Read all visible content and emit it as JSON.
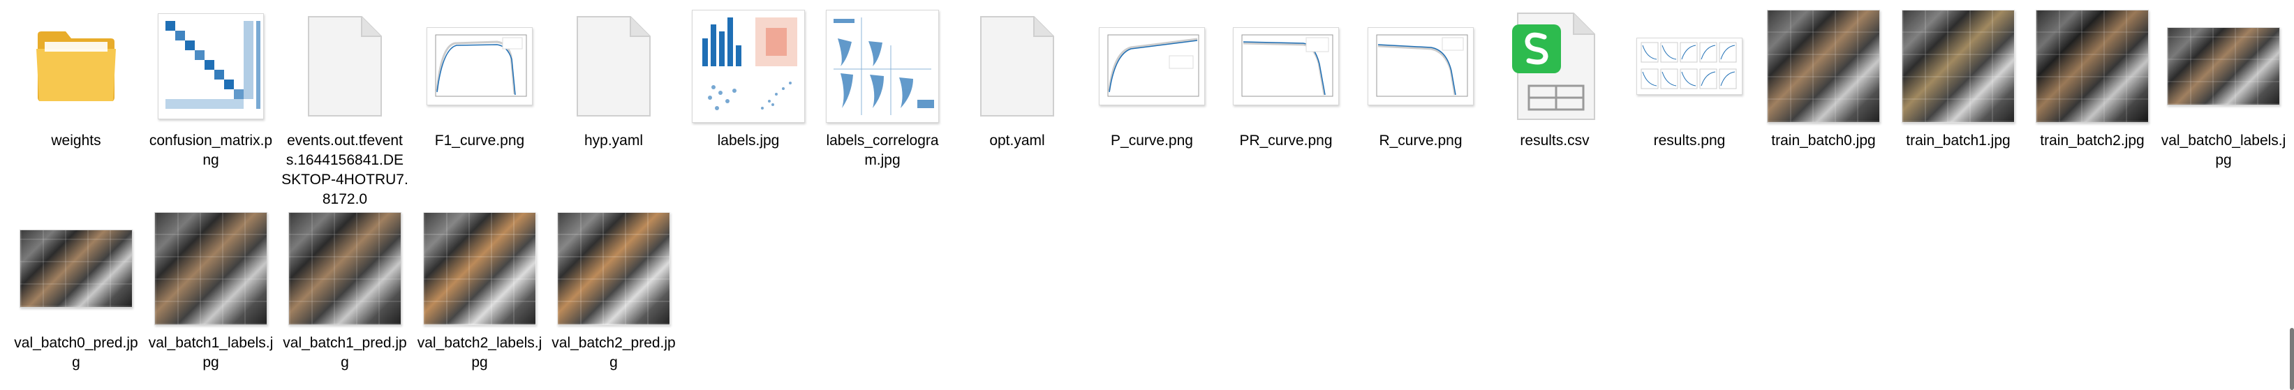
{
  "files": [
    {
      "name": "weights",
      "kind": "folder"
    },
    {
      "name": "confusion_matrix.png",
      "kind": "confusion"
    },
    {
      "name": "events.out.tfevents.1644156841.DESKTOP-4HOTRU7.8172.0",
      "kind": "blank"
    },
    {
      "name": "F1_curve.png",
      "kind": "curve"
    },
    {
      "name": "hyp.yaml",
      "kind": "blank"
    },
    {
      "name": "labels.jpg",
      "kind": "labels"
    },
    {
      "name": "labels_correlogram.jpg",
      "kind": "correlogram"
    },
    {
      "name": "opt.yaml",
      "kind": "blank"
    },
    {
      "name": "P_curve.png",
      "kind": "curve"
    },
    {
      "name": "PR_curve.png",
      "kind": "curve"
    },
    {
      "name": "R_curve.png",
      "kind": "curve"
    },
    {
      "name": "results.csv",
      "kind": "csv"
    },
    {
      "name": "results.png",
      "kind": "results"
    },
    {
      "name": "train_batch0.jpg",
      "kind": "photo"
    },
    {
      "name": "train_batch1.jpg",
      "kind": "photo"
    },
    {
      "name": "train_batch2.jpg",
      "kind": "photo"
    },
    {
      "name": "val_batch0_labels.jpg",
      "kind": "photo-wide"
    },
    {
      "name": "val_batch0_pred.jpg",
      "kind": "photo-wide"
    },
    {
      "name": "val_batch1_labels.jpg",
      "kind": "photo"
    },
    {
      "name": "val_batch1_pred.jpg",
      "kind": "photo"
    },
    {
      "name": "val_batch2_labels.jpg",
      "kind": "photo"
    },
    {
      "name": "val_batch2_pred.jpg",
      "kind": "photo"
    }
  ],
  "colors": {
    "folder": "#f5c34a",
    "folder_dark": "#e8ac2b",
    "csv_green": "#2dbb4e",
    "chart_blue": "#1f6fb5"
  }
}
